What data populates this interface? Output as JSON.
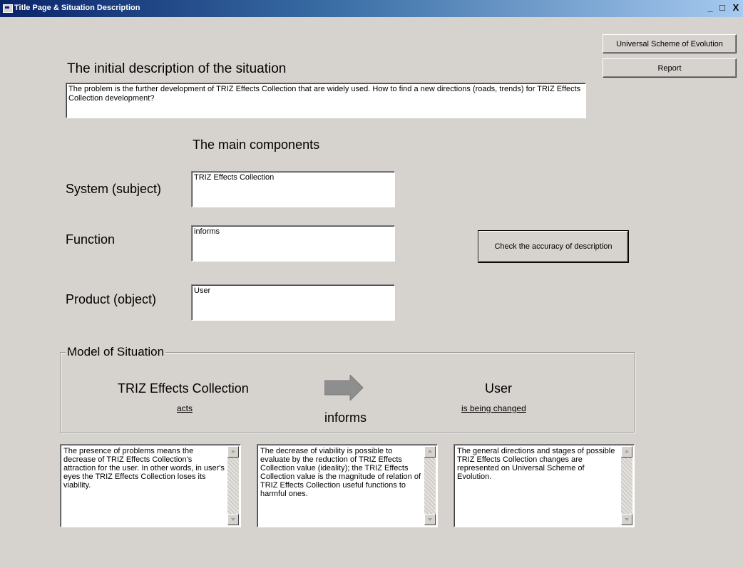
{
  "window": {
    "title": "Title Page & Situation Description",
    "controls": {
      "minimize": "_",
      "maximize": "□",
      "close": "X"
    }
  },
  "buttons": {
    "universal_scheme": "Universal Scheme of Evolution",
    "report": "Report",
    "check_accuracy": "Check the accuracy of description"
  },
  "initial": {
    "heading": "The initial description of the situation",
    "text": "The problem is the further development of TRIZ Effects Collection that are widely used. How to find a new directions (roads, trends) for TRIZ Effects Collection development?"
  },
  "components": {
    "heading": "The main components",
    "system_label": "System (subject)",
    "system_value": "TRIZ Effects Collection",
    "function_label": "Function",
    "function_value": "informs",
    "product_label": "Product (object)",
    "product_value": "User"
  },
  "model": {
    "caption": "Model of Situation",
    "subject": "TRIZ Effects Collection",
    "subject_role": "acts",
    "function": "informs",
    "object": "User",
    "object_role": "is being changed"
  },
  "notes": [
    "The presence of problems means the decrease of TRIZ Effects Collection's attraction for the user. In other words, in user's eyes the TRIZ Effects Collection loses its viability.",
    "The decrease of viability is possible to evaluate by  the reduction of TRIZ Effects Collection value (ideality); the TRIZ Effects Collection value is the magnitude of relation of TRIZ Effects Collection useful functions to harmful ones.",
    "The general directions and stages of possible TRIZ Effects Collection changes are represented on Universal Scheme of Evolution."
  ],
  "icons": {
    "app": "form-icon",
    "arrow": "right-arrow-icon",
    "scroll_up": "scroll-up-icon",
    "scroll_down": "scroll-down-icon"
  },
  "colors": {
    "window_bg": "#d6d3ce",
    "titlebar_start": "#0a246a",
    "titlebar_end": "#a6caf0",
    "arrow": "#8e8e8e"
  }
}
